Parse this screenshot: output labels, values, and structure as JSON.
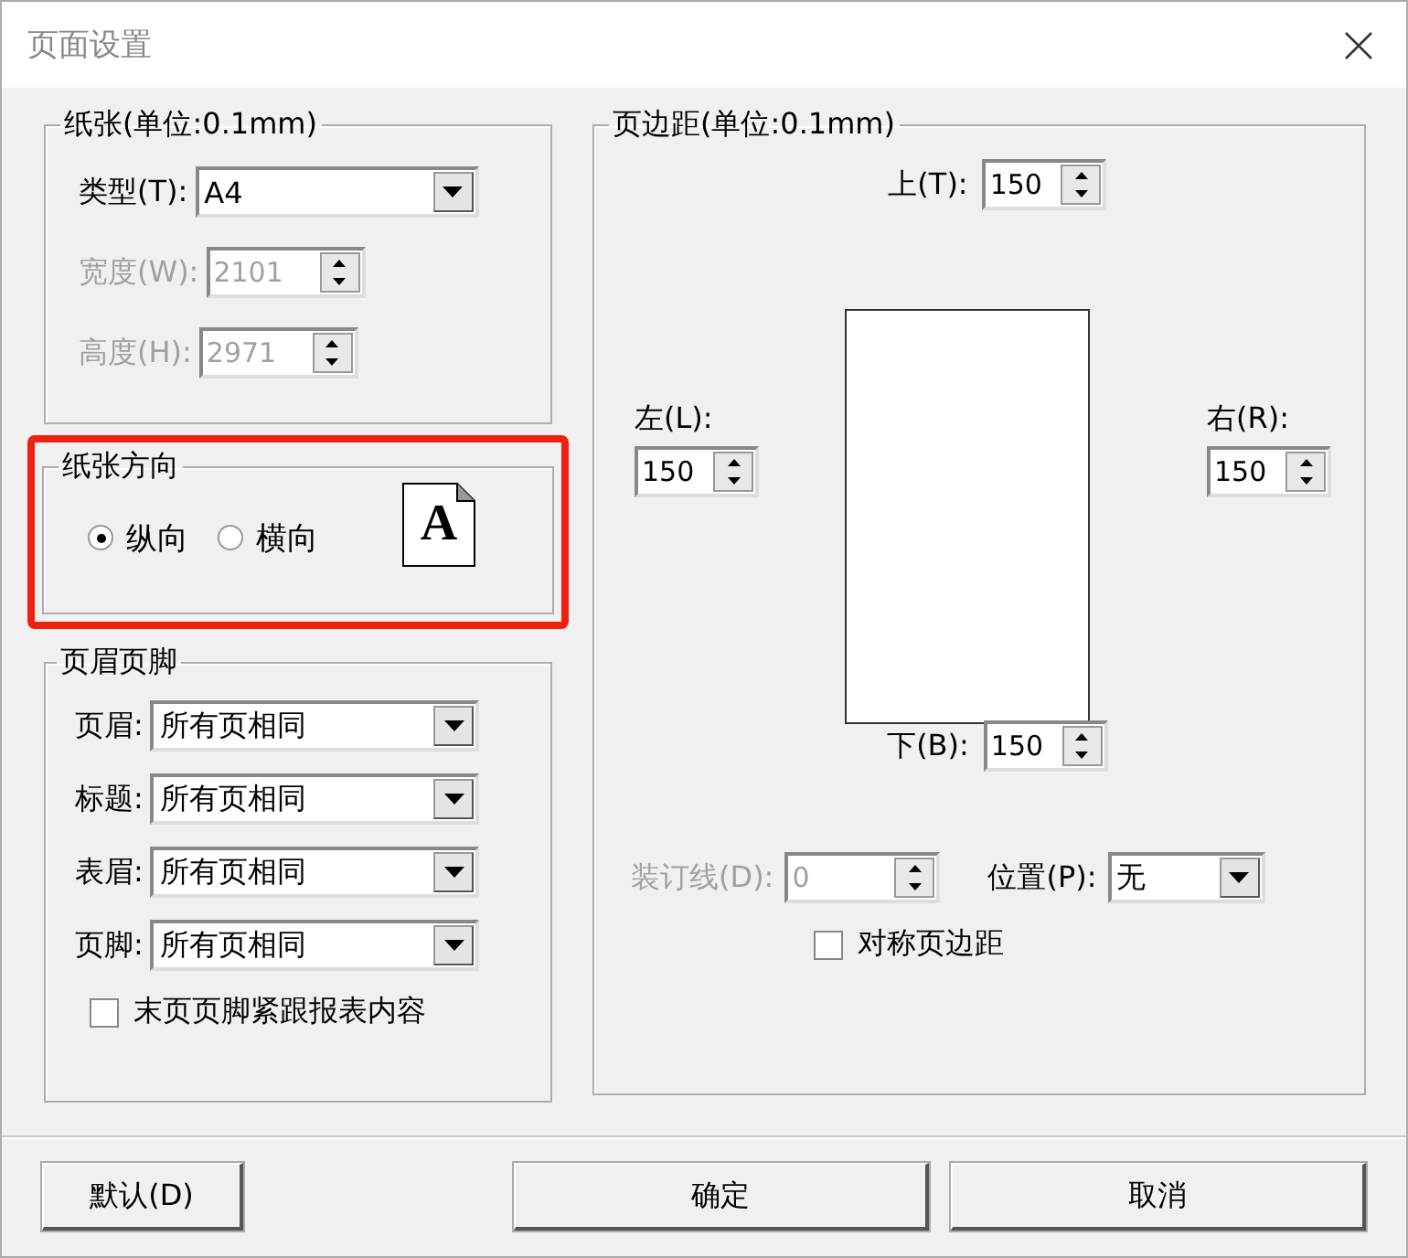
{
  "window": {
    "title": "页面设置"
  },
  "paper": {
    "legend": "纸张(单位:0.1mm)",
    "type": {
      "label": "类型(T):",
      "value": "A4",
      "disabled": false
    },
    "width": {
      "label": "宽度(W):",
      "value": "2101",
      "disabled": true
    },
    "height": {
      "label": "高度(H):",
      "value": "2971",
      "disabled": true
    }
  },
  "orientation": {
    "legend": "纸张方向",
    "options": [
      {
        "label": "纵向",
        "selected": true
      },
      {
        "label": "横向",
        "selected": false
      }
    ],
    "icon_letter": "A"
  },
  "header_footer": {
    "legend": "页眉页脚",
    "rows": [
      {
        "label": "页眉:",
        "value": "所有页相同"
      },
      {
        "label": "标题:",
        "value": "所有页相同"
      },
      {
        "label": "表眉:",
        "value": "所有页相同"
      },
      {
        "label": "页脚:",
        "value": "所有页相同"
      }
    ],
    "checkbox": {
      "label": "末页页脚紧跟报表内容",
      "checked": false
    }
  },
  "margins": {
    "legend": "页边距(单位:0.1mm)",
    "top": {
      "label": "上(T):",
      "value": "150",
      "disabled": false
    },
    "left": {
      "label": "左(L):",
      "value": "150",
      "disabled": false
    },
    "right": {
      "label": "右(R):",
      "value": "150",
      "disabled": false
    },
    "bottom": {
      "label": "下(B):",
      "value": "150",
      "disabled": false
    },
    "gutter": {
      "label": "装订线(D):",
      "value": "0",
      "disabled": true
    },
    "position": {
      "label": "位置(P):",
      "value": "无",
      "disabled": false
    },
    "symmetric": {
      "label": "对称页边距",
      "checked": false
    }
  },
  "buttons": [
    {
      "label": "默认(D)",
      "kind": "left"
    },
    {
      "label": "确定",
      "kind": "right"
    },
    {
      "label": "取消",
      "kind": "right"
    }
  ]
}
